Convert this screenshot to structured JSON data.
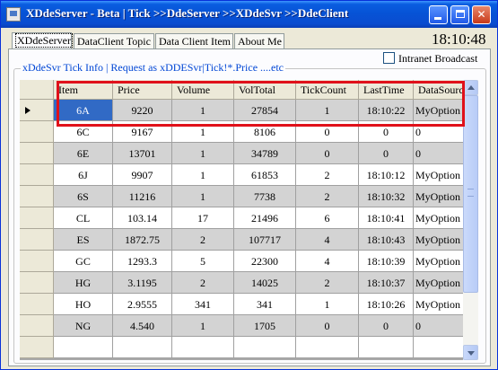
{
  "window": {
    "title": "XDdeServer - Beta | Tick >>DdeServer >>XDdeSvr >>DdeClient"
  },
  "tabs": [
    {
      "label": "XDdeServer"
    },
    {
      "label": "DataClient Topic"
    },
    {
      "label": "Data Client Item"
    },
    {
      "label": "About Me"
    }
  ],
  "clock": "18:10:48",
  "broadcast": {
    "label": "Intranet Broadcast",
    "checked": false
  },
  "group_label": "xDdeSvr Tick Info | Request as xDDESvr|Tick!*.Price ....etc",
  "table": {
    "columns": [
      "Item",
      "Price",
      "Volume",
      "VolTotal",
      "TickCount",
      "LastTime",
      "DataSource"
    ],
    "rows": [
      [
        "6A",
        "9220",
        "1",
        "27854",
        "1",
        "18:10:22",
        "MyOption"
      ],
      [
        "6C",
        "9167",
        "1",
        "8106",
        "0",
        "0",
        "0"
      ],
      [
        "6E",
        "13701",
        "1",
        "34789",
        "0",
        "0",
        "0"
      ],
      [
        "6J",
        "9907",
        "1",
        "61853",
        "2",
        "18:10:12",
        "MyOption"
      ],
      [
        "6S",
        "11216",
        "1",
        "7738",
        "2",
        "18:10:32",
        "MyOption"
      ],
      [
        "CL",
        "103.14",
        "17",
        "21496",
        "6",
        "18:10:41",
        "MyOption"
      ],
      [
        "ES",
        "1872.75",
        "2",
        "107717",
        "4",
        "18:10:43",
        "MyOption"
      ],
      [
        "GC",
        "1293.3",
        "5",
        "22300",
        "4",
        "18:10:39",
        "MyOption"
      ],
      [
        "HG",
        "3.1195",
        "2",
        "14025",
        "2",
        "18:10:37",
        "MyOption"
      ],
      [
        "HO",
        "2.9555",
        "341",
        "341",
        "1",
        "18:10:26",
        "MyOption"
      ],
      [
        "NG",
        "4.540",
        "1",
        "1705",
        "0",
        "0",
        "0"
      ],
      [
        "",
        "",
        "",
        "",
        "",
        "",
        ""
      ]
    ],
    "current_row": 0,
    "selected_cell": "6A"
  },
  "icons": {
    "app": "app-window-icon",
    "minimize": "minimize-icon",
    "maximize": "maximize-icon",
    "close": "close-icon",
    "row_pointer": "row-pointer-icon"
  },
  "colors": {
    "titlebar": "#0653d6",
    "selection": "#316ac5",
    "highlight_box": "#e0111a",
    "group_label": "#0046d5"
  }
}
